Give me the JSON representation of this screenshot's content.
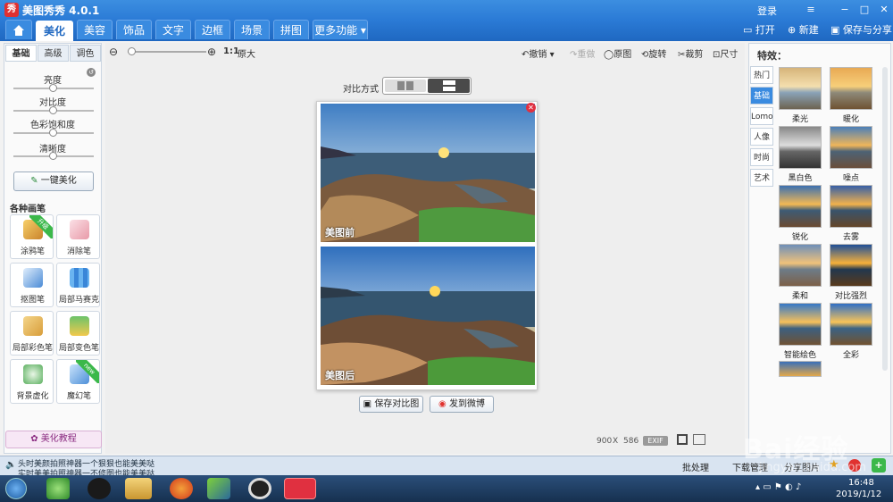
{
  "window": {
    "title": "美图秀秀 4.0.1",
    "login": "登录",
    "min": "−",
    "restore": "□",
    "close": "✕",
    "menu_glyph": "≡"
  },
  "menu": {
    "tabs": [
      "美化",
      "美容",
      "饰品",
      "文字",
      "边框",
      "场景",
      "拼图",
      "更多功能 ▾"
    ],
    "open": "打开",
    "new": "新建",
    "save": "保存与分享"
  },
  "left": {
    "subtabs": [
      "基础",
      "高级",
      "调色"
    ],
    "sliders": [
      "亮度",
      "对比度",
      "色彩饱和度",
      "清晰度"
    ],
    "oneclick": "一键美化",
    "brush_title": "各种画笔",
    "brushes": [
      {
        "label": "涂鸦笔",
        "badge": "升级"
      },
      {
        "label": "消除笔",
        "badge": ""
      },
      {
        "label": "抠图笔",
        "badge": ""
      },
      {
        "label": "局部马赛克",
        "badge": ""
      },
      {
        "label": "局部彩色笔",
        "badge": ""
      },
      {
        "label": "局部变色笔",
        "badge": ""
      },
      {
        "label": "背景虚化",
        "badge": ""
      },
      {
        "label": "魔幻笔",
        "badge": "new"
      }
    ],
    "tutorial": "美化教程"
  },
  "toolbar": {
    "zoom_ratio": "1:1",
    "zoom_label": "原大",
    "undo": "撤销",
    "redo": "重做",
    "original": "原图",
    "rotate": "旋转",
    "crop": "裁剪",
    "size": "尺寸"
  },
  "compare": {
    "label": "对比方式",
    "before": "美图前",
    "after": "美图后",
    "save": "保存对比图",
    "share": "发到微博"
  },
  "info": {
    "width": "900",
    "times": "X",
    "height": "586",
    "exif": "EXIF"
  },
  "right": {
    "title": "特效：",
    "categories": [
      "热门",
      "基础",
      "Lomo",
      "人像",
      "时尚",
      "艺术"
    ],
    "effects": [
      "柔光",
      "暖化",
      "黑白色",
      "噪点",
      "锐化",
      "去雾",
      "柔和",
      "对比强烈",
      "智能绘色",
      "全彩"
    ]
  },
  "status": {
    "line1": "头时美颜拍照神器一个狠狠也能美美哒",
    "line2": "实时美美拍照神器一不修图也能美美哒",
    "batch": "批处理",
    "download": "下载管理",
    "share_pic": "分享图片"
  },
  "taskbar": {
    "time": "16:48",
    "date": "2019/1/12"
  },
  "watermark": {
    "text": "Bai经验",
    "url": "jingyan.baidu.com"
  },
  "colors": {
    "accent": "#2b7bd6",
    "active": "#3a8be0"
  }
}
